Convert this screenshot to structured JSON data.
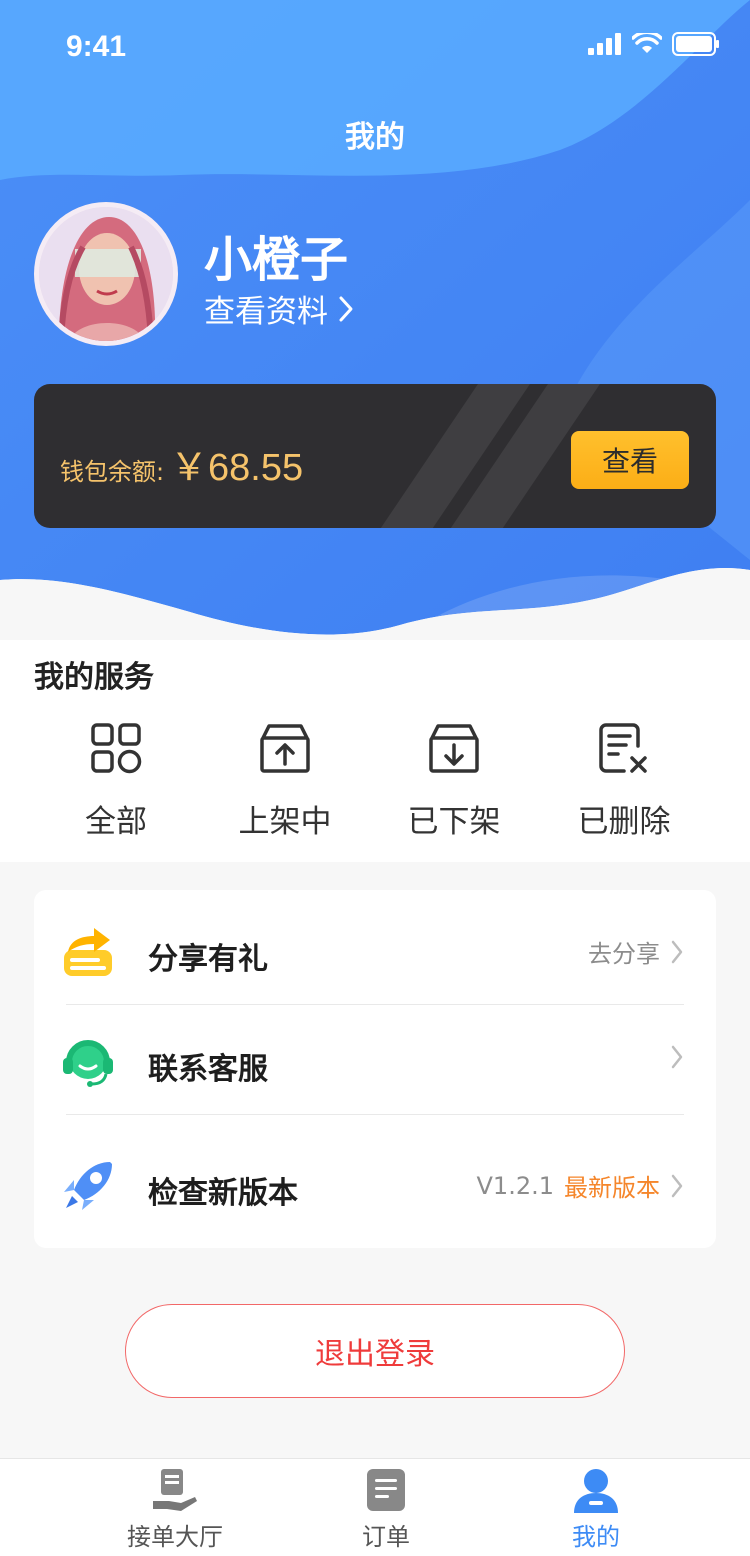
{
  "status_bar": {
    "time": "9:41"
  },
  "header": {
    "title": "我的"
  },
  "profile": {
    "name": "小橙子",
    "link_label": "查看资料"
  },
  "wallet": {
    "label": "钱包余额:",
    "amount": "￥68.55",
    "button_label": "查看"
  },
  "services": {
    "title": "我的服务",
    "items": [
      {
        "label": "全部",
        "icon": "grid-icon"
      },
      {
        "label": "上架中",
        "icon": "box-upload-icon"
      },
      {
        "label": "已下架",
        "icon": "box-download-icon"
      },
      {
        "label": "已删除",
        "icon": "document-delete-icon"
      }
    ]
  },
  "menu": [
    {
      "label": "分享有礼",
      "right_text": "去分享",
      "icon": "share-gift-icon"
    },
    {
      "label": "联系客服",
      "right_text": "",
      "icon": "customer-service-icon"
    },
    {
      "label": "检查新版本",
      "version": "V1.2.1",
      "right_text": "最新版本",
      "icon": "rocket-icon"
    }
  ],
  "logout_label": "退出登录",
  "tabbar": [
    {
      "label": "接单大厅",
      "icon": "order-hall-icon",
      "active": false
    },
    {
      "label": "订单",
      "icon": "order-list-icon",
      "active": false
    },
    {
      "label": "我的",
      "icon": "user-icon",
      "active": true
    }
  ],
  "colors": {
    "accent": "#3d8bf5",
    "wallet_gold": "#f5c36b",
    "logout_red": "#ef3b3b",
    "version_orange": "#f5862b"
  }
}
